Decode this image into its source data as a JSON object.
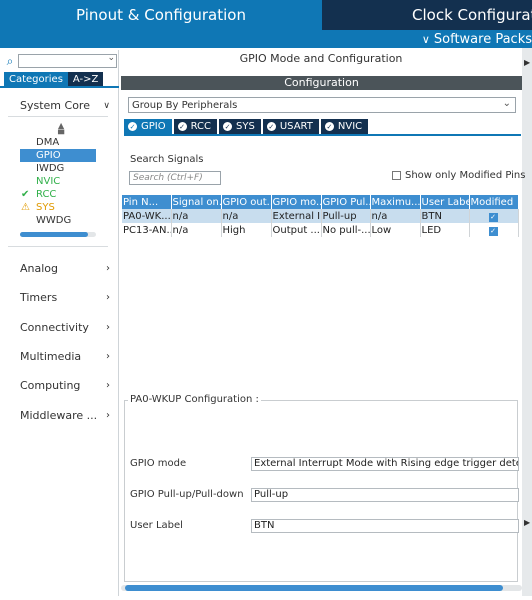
{
  "top_tabs": {
    "pinout": "Pinout & Configuration",
    "clock": "Clock Configuration",
    "software_packs": "Software Packs"
  },
  "left": {
    "tabs": [
      "Categories",
      "A->Z"
    ],
    "system_core": "System Core",
    "items": [
      {
        "label": "DMA",
        "state": "normal"
      },
      {
        "label": "GPIO",
        "state": "selected"
      },
      {
        "label": "IWDG",
        "state": "normal"
      },
      {
        "label": "NVIC",
        "state": "green"
      },
      {
        "label": "RCC",
        "state": "checked"
      },
      {
        "label": "SYS",
        "state": "warning"
      },
      {
        "label": "WWDG",
        "state": "normal"
      }
    ],
    "sections": [
      "Analog",
      "Timers",
      "Connectivity",
      "Multimedia",
      "Computing",
      "Middleware ..."
    ]
  },
  "main": {
    "title": "GPIO Mode and Configuration",
    "config_header": "Configuration",
    "group_by": "Group By Peripherals",
    "tabs": [
      "GPIO",
      "RCC",
      "SYS",
      "USART",
      "NVIC"
    ],
    "search_label": "Search Signals",
    "search_placeholder": "Search (Ctrl+F)",
    "only_modified": "Show only Modified Pins",
    "columns": [
      "Pin N...",
      "Signal on...",
      "GPIO out...",
      "GPIO mo...",
      "GPIO Pul...",
      "Maximu...",
      "User Label",
      "Modified"
    ],
    "rows": [
      [
        "PA0-WK...",
        "n/a",
        "n/a",
        "External I...",
        "Pull-up",
        "n/a",
        "BTN",
        true
      ],
      [
        "PC13-AN...",
        "n/a",
        "High",
        "Output ...",
        "No pull-...",
        "Low",
        "LED",
        true
      ]
    ],
    "pin_config": {
      "legend": "PA0-WKUP Configuration :",
      "gpio_mode_label": "GPIO mode",
      "gpio_mode_value": "External Interrupt Mode with Rising edge trigger detection",
      "pull_label": "GPIO Pull-up/Pull-down",
      "pull_value": "Pull-up",
      "user_label_label": "User Label",
      "user_label_value": "BTN"
    }
  },
  "colors": {
    "accent": "#0f77b5",
    "dark_navy": "#13304f",
    "selection": "#3e8ed0",
    "green": "#31b04a",
    "warning": "#e19a00"
  }
}
